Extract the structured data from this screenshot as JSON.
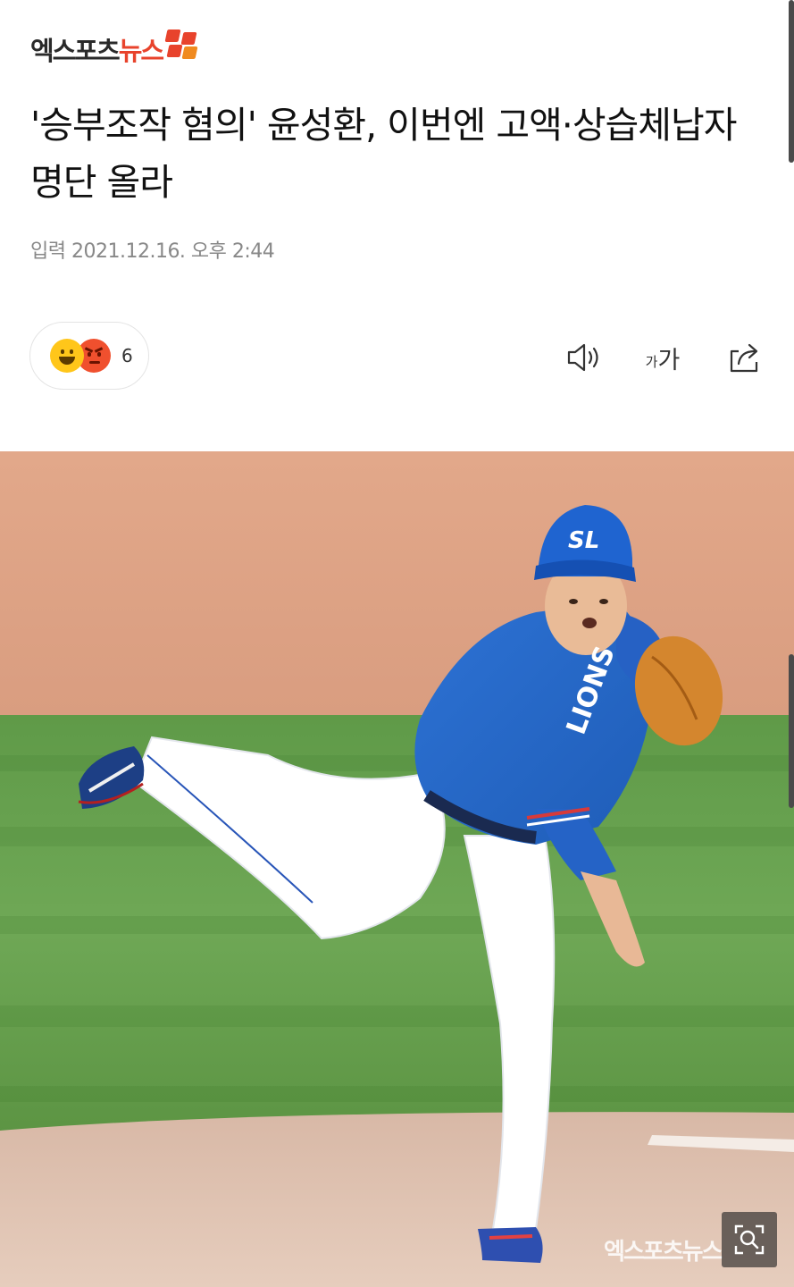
{
  "header": {
    "logo_text_dark": "엑스포츠",
    "logo_text_red": "뉴스",
    "logo_colors": {
      "red": "#e8432c",
      "orange": "#f08a1f",
      "dark": "#2a2a2a"
    }
  },
  "article": {
    "headline": "'승부조작 혐의' 윤성환, 이번엔 고액·상습체납자 명단 올라",
    "dateline": "입력 2021.12.16. 오후 2:44"
  },
  "reactions": {
    "emojis": [
      "smile-emoji",
      "angry-emoji"
    ],
    "count": "6"
  },
  "toolbar": {
    "speaker_icon": "speaker-icon",
    "font_small": "가",
    "font_big": "가",
    "share_icon": "share-icon"
  },
  "photo": {
    "subject": "baseball-pitcher",
    "cap_letters": "SL",
    "watermark": "엑스포츠뉴스",
    "zoom_icon": "zoom-icon"
  }
}
